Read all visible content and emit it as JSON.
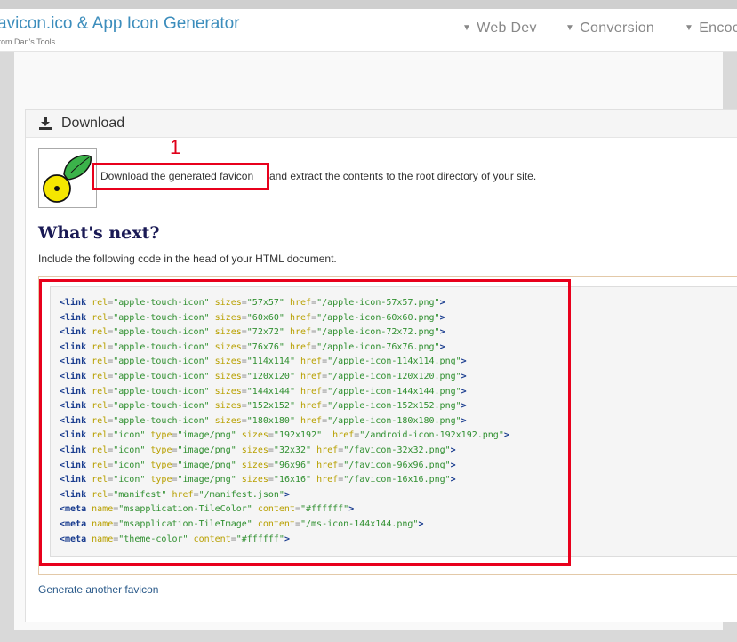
{
  "header": {
    "brand": "avicon.ico & App Icon Generator",
    "brand_sub": "rom Dan's Tools",
    "nav": [
      {
        "label": "Web Dev"
      },
      {
        "label": "Conversion"
      },
      {
        "label": "Encoc"
      }
    ]
  },
  "panel": {
    "title": "Download",
    "step_number": "1",
    "download_link": "Download the generated favicon",
    "download_rest": "and extract the contents to the root directory of your site.",
    "whats_next": "What's next?",
    "include_text": "Include the following code in the head of your HTML document.",
    "generate_another": "Generate another favicon"
  },
  "code_lines": [
    "<link rel=\"apple-touch-icon\" sizes=\"57x57\" href=\"/apple-icon-57x57.png\">",
    "<link rel=\"apple-touch-icon\" sizes=\"60x60\" href=\"/apple-icon-60x60.png\">",
    "<link rel=\"apple-touch-icon\" sizes=\"72x72\" href=\"/apple-icon-72x72.png\">",
    "<link rel=\"apple-touch-icon\" sizes=\"76x76\" href=\"/apple-icon-76x76.png\">",
    "<link rel=\"apple-touch-icon\" sizes=\"114x114\" href=\"/apple-icon-114x114.png\">",
    "<link rel=\"apple-touch-icon\" sizes=\"120x120\" href=\"/apple-icon-120x120.png\">",
    "<link rel=\"apple-touch-icon\" sizes=\"144x144\" href=\"/apple-icon-144x144.png\">",
    "<link rel=\"apple-touch-icon\" sizes=\"152x152\" href=\"/apple-icon-152x152.png\">",
    "<link rel=\"apple-touch-icon\" sizes=\"180x180\" href=\"/apple-icon-180x180.png\">",
    "<link rel=\"icon\" type=\"image/png\" sizes=\"192x192\"  href=\"/android-icon-192x192.png\">",
    "<link rel=\"icon\" type=\"image/png\" sizes=\"32x32\" href=\"/favicon-32x32.png\">",
    "<link rel=\"icon\" type=\"image/png\" sizes=\"96x96\" href=\"/favicon-96x96.png\">",
    "<link rel=\"icon\" type=\"image/png\" sizes=\"16x16\" href=\"/favicon-16x16.png\">",
    "<link rel=\"manifest\" href=\"/manifest.json\">",
    "<meta name=\"msapplication-TileColor\" content=\"#ffffff\">",
    "<meta name=\"msapplication-TileImage\" content=\"/ms-icon-144x144.png\">",
    "<meta name=\"theme-color\" content=\"#ffffff\">"
  ],
  "colors": {
    "brand": "#3c8dbc",
    "highlight": "#e8001c",
    "tag": "#1a3d8f",
    "attr": "#b8a000",
    "string": "#2f8f2f"
  }
}
